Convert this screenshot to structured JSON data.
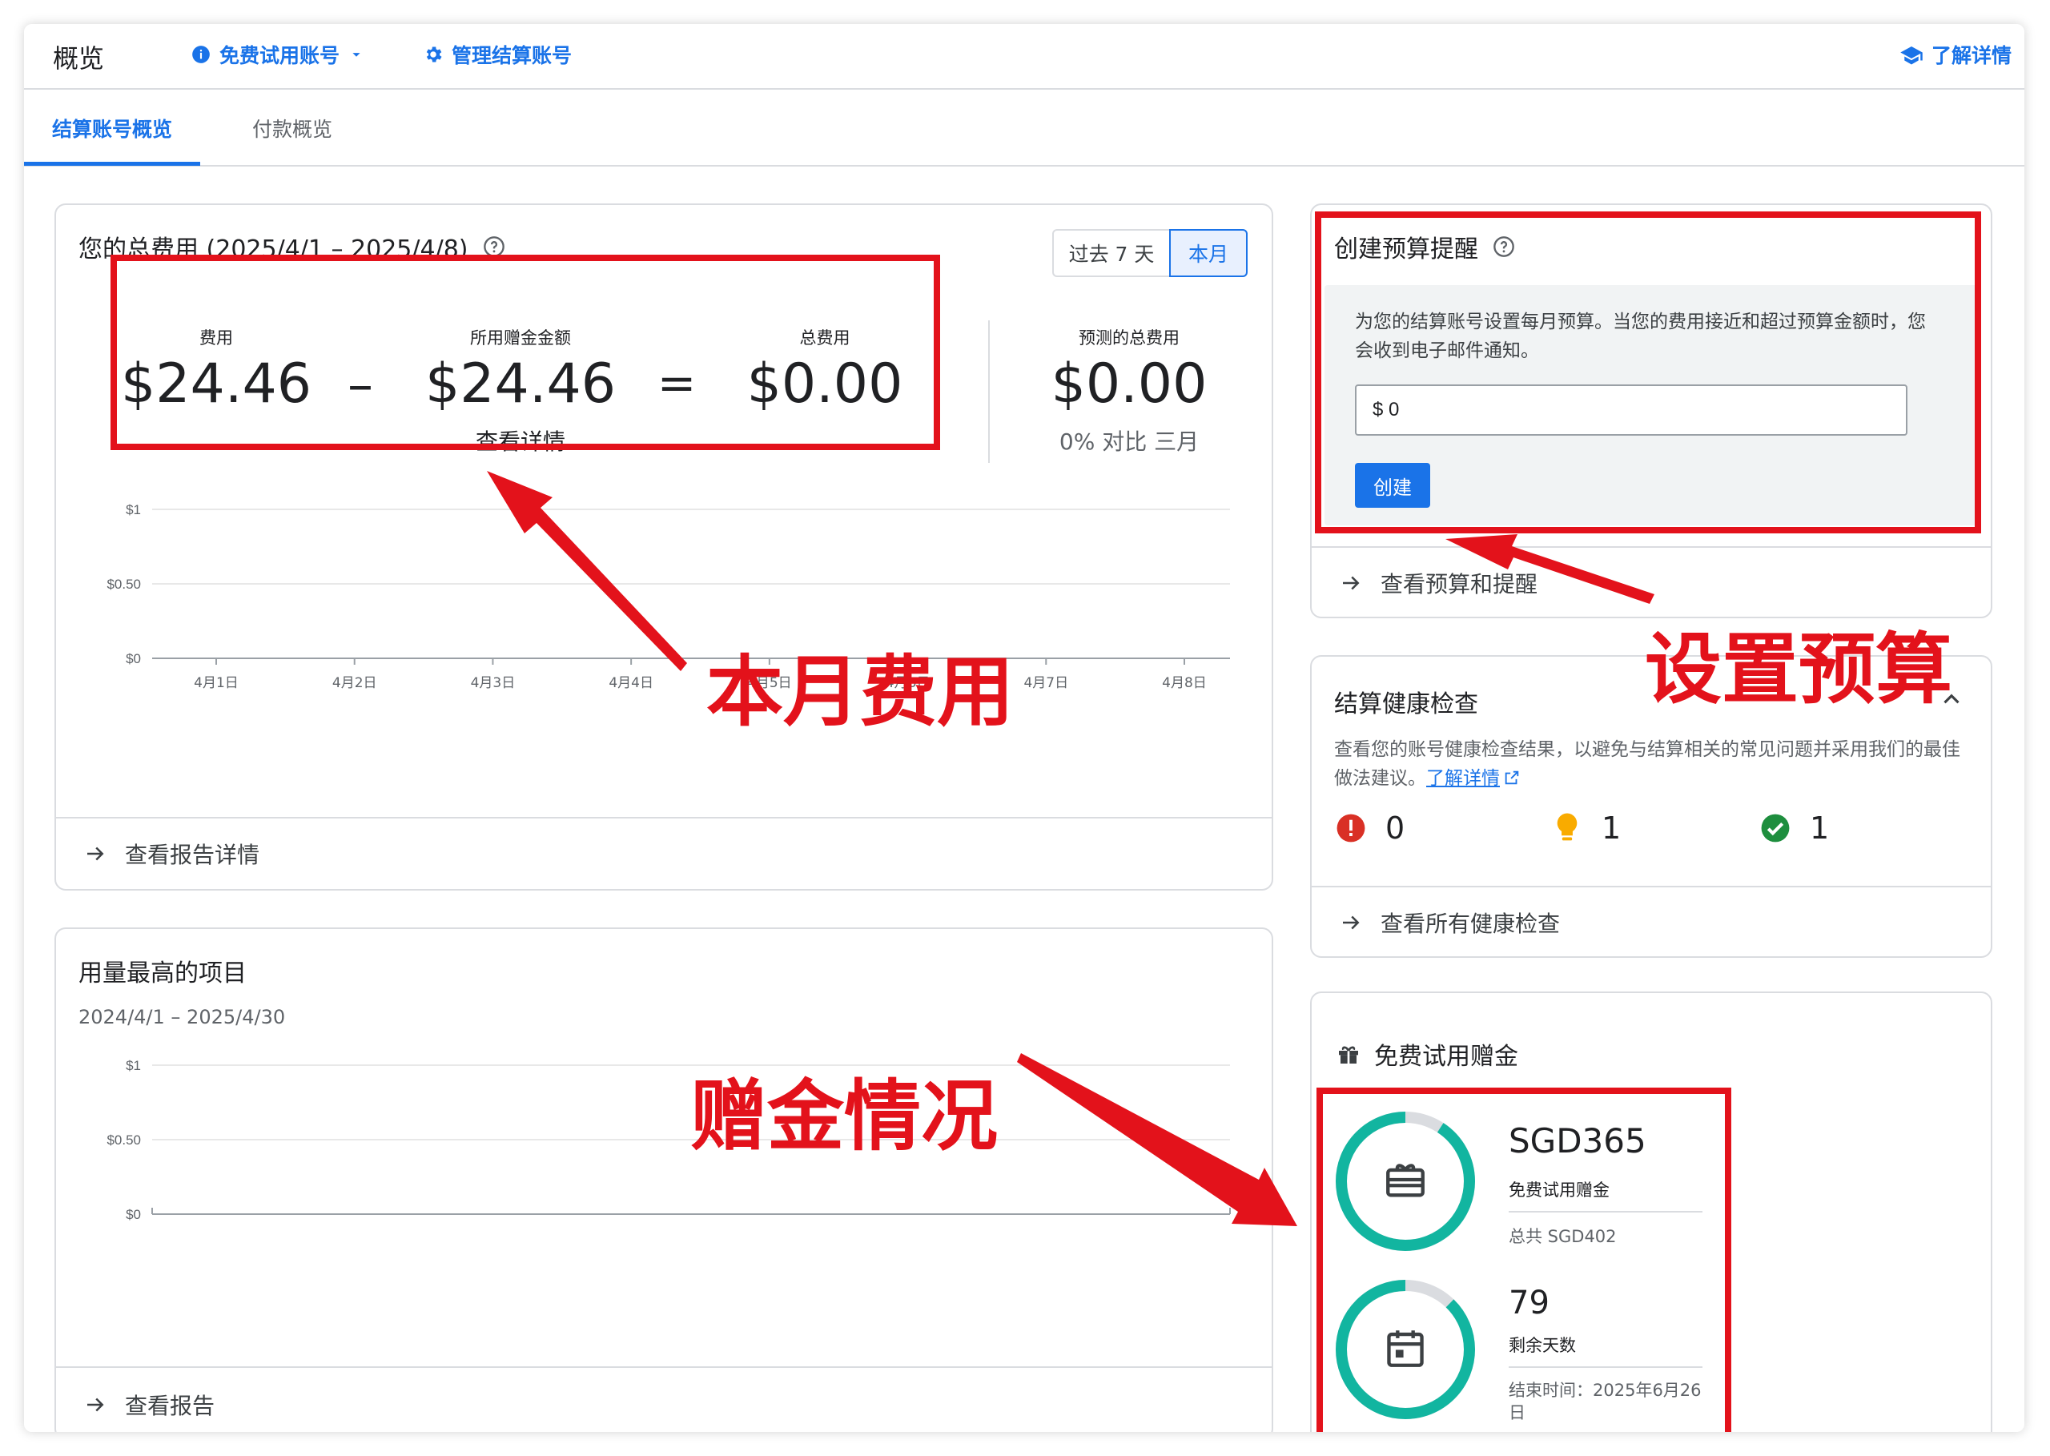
{
  "topbar": {
    "title": "概览",
    "trial_account": "免费试用账号",
    "manage_billing": "管理结算账号",
    "learn_more": "了解详情"
  },
  "tabs": [
    {
      "label": "结算账号概览",
      "active": true
    },
    {
      "label": "付款概览",
      "active": false
    }
  ],
  "total_cost": {
    "title": "您的总费用 (2025/4/1 – 2025/4/8)",
    "range_buttons": [
      "过去 7 天",
      "本月"
    ],
    "selected_range": "本月",
    "cost_label": "费用",
    "cost_value": "$24.46",
    "minus": "–",
    "credits_label": "所用赠金金额",
    "credits_value": "$24.46",
    "equals": "=",
    "total_label": "总费用",
    "total_value": "$0.00",
    "view_details": "查看详情",
    "forecast_label": "预测的总费用",
    "forecast_value": "$0.00",
    "forecast_compare": "0% 对比 三月",
    "view_report_details": "查看报告详情"
  },
  "chart_data": [
    {
      "type": "line",
      "categories": [
        "4月1日",
        "4月2日",
        "4月3日",
        "4月4日",
        "4月5日",
        "4月6日",
        "4月7日",
        "4月8日"
      ],
      "series": [],
      "yticks": [
        "$0",
        "$0.50",
        "$1"
      ],
      "ylim": [
        0,
        1
      ],
      "grid": true
    },
    {
      "type": "line",
      "categories": [],
      "series": [],
      "yticks": [
        "$0",
        "$0.50",
        "$1"
      ],
      "ylim": [
        0,
        1
      ],
      "grid": true
    }
  ],
  "top_projects": {
    "title": "用量最高的项目",
    "date_range": "2024/4/1 – 2025/4/30",
    "view_report": "查看报告"
  },
  "budget": {
    "title": "创建预算提醒",
    "description": "为您的结算账号设置每月预算。当您的费用接近和超过预算金额时，您会收到电子邮件通知。",
    "input_value": "$ 0",
    "create_button": "创建",
    "view_budgets": "查看预算和提醒"
  },
  "health": {
    "title": "结算健康检查",
    "description": "查看您的账号健康检查结果，以避免与结算相关的常见问题并采用我们的最佳做法建议。",
    "learn_more": "了解详情",
    "counts": {
      "error": "0",
      "warning": "1",
      "ok": "1"
    },
    "view_all": "查看所有健康检查"
  },
  "credits": {
    "title": "免费试用赠金",
    "amount": "SGD365",
    "amount_label": "免费试用赠金",
    "total": "总共 SGD402",
    "amount_fraction_remaining": 0.908,
    "days": "79",
    "days_label": "剩余天数",
    "end_date": "结束时间：2025年6月26日",
    "days_fraction_remaining": 0.878,
    "ring_color": "#12b5a0"
  },
  "annotations": {
    "monthly_cost": "本月费用",
    "set_budget": "设置预算",
    "credit_status": "赠金情况"
  },
  "colors": {
    "accent": "#1a73e8",
    "annotation_red": "#e3121b",
    "error": "#d93025",
    "warning": "#f9ab00",
    "ok": "#1e8e3e"
  }
}
